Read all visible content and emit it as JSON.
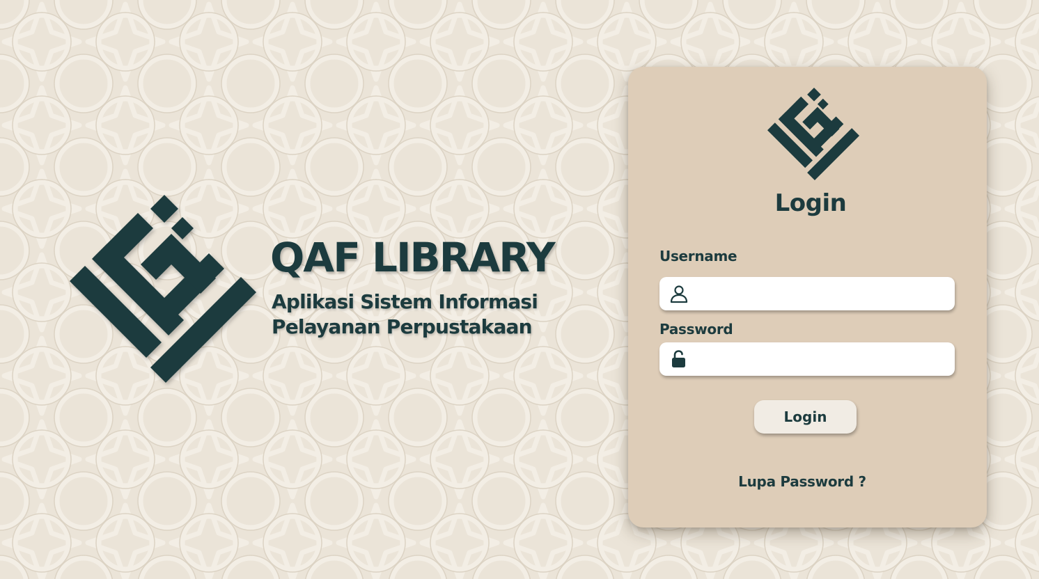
{
  "brand": {
    "title": "QAF LIBRARY",
    "subtitle_line1": "Aplikasi Sistem Informasi",
    "subtitle_line2": "Pelayanan Perpustakaan",
    "logo_icon": "qaf-library-logo-icon"
  },
  "login": {
    "title": "Login",
    "username_label": "Username",
    "username_value": "",
    "username_icon": "user-icon",
    "password_label": "Password",
    "password_value": "",
    "password_icon": "unlock-icon",
    "submit_label": "Login",
    "forgot_label": "Lupa Password ?"
  },
  "colors": {
    "primary": "#1c3b3e",
    "background": "#ebe4d8",
    "card": "#decdb8",
    "button": "#f1ece4",
    "input": "#ffffff"
  }
}
